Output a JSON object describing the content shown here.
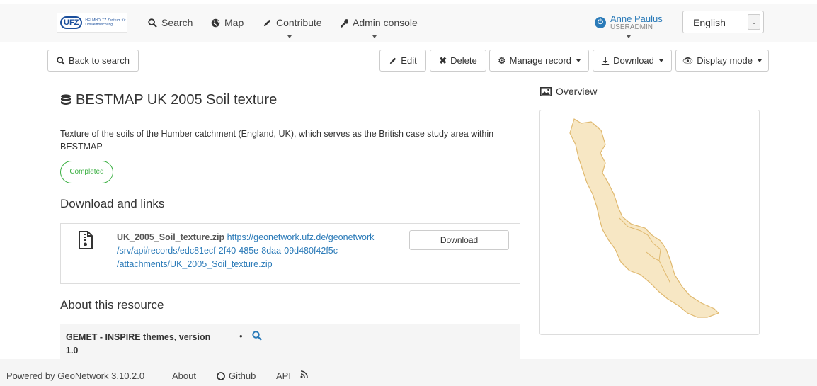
{
  "nav": {
    "logo_main": "UFZ",
    "logo_sub": "HELMHOLTZ Zentrum für Umweltforschung",
    "search": "Search",
    "map": "Map",
    "contribute": "Contribute",
    "admin": "Admin console"
  },
  "user": {
    "name": "Anne Paulus",
    "role": "USERADMIN"
  },
  "language": {
    "selected": "English"
  },
  "toolbar": {
    "back": "Back to search",
    "edit": "Edit",
    "delete": "Delete",
    "manage": "Manage record",
    "download": "Download",
    "display": "Display mode"
  },
  "record": {
    "title": "BESTMAP UK 2005 Soil texture",
    "abstract": "Texture of the soils of the Humber catchment (England, UK), which serves as the British case study area within BESTMAP",
    "status": "Completed"
  },
  "downloads": {
    "heading": "Download and links",
    "file_name": "UK_2005_Soil_texture.zip",
    "url_line1": "https://geonetwork.ufz.de/geonetwork",
    "url_line2": "/srv/api/records/edc81ecf-2f40-485e-8daa-09d480f42f5c",
    "url_line3": "/attachments/UK_2005_Soil_texture.zip",
    "button": "Download"
  },
  "about": {
    "heading": "About this resource",
    "gemet_label": "GEMET - INSPIRE themes, version 1.0",
    "bullet": "•"
  },
  "overview": {
    "heading": "Overview"
  },
  "footer": {
    "powered": "Powered by GeoNetwork 3.10.2.0",
    "about": "About",
    "github": "Github",
    "api": "API"
  },
  "colors": {
    "link": "#2a7ab8",
    "status": "#3cb043",
    "map_fill": "#f7e7c4",
    "map_stroke": "#e0b96f"
  }
}
